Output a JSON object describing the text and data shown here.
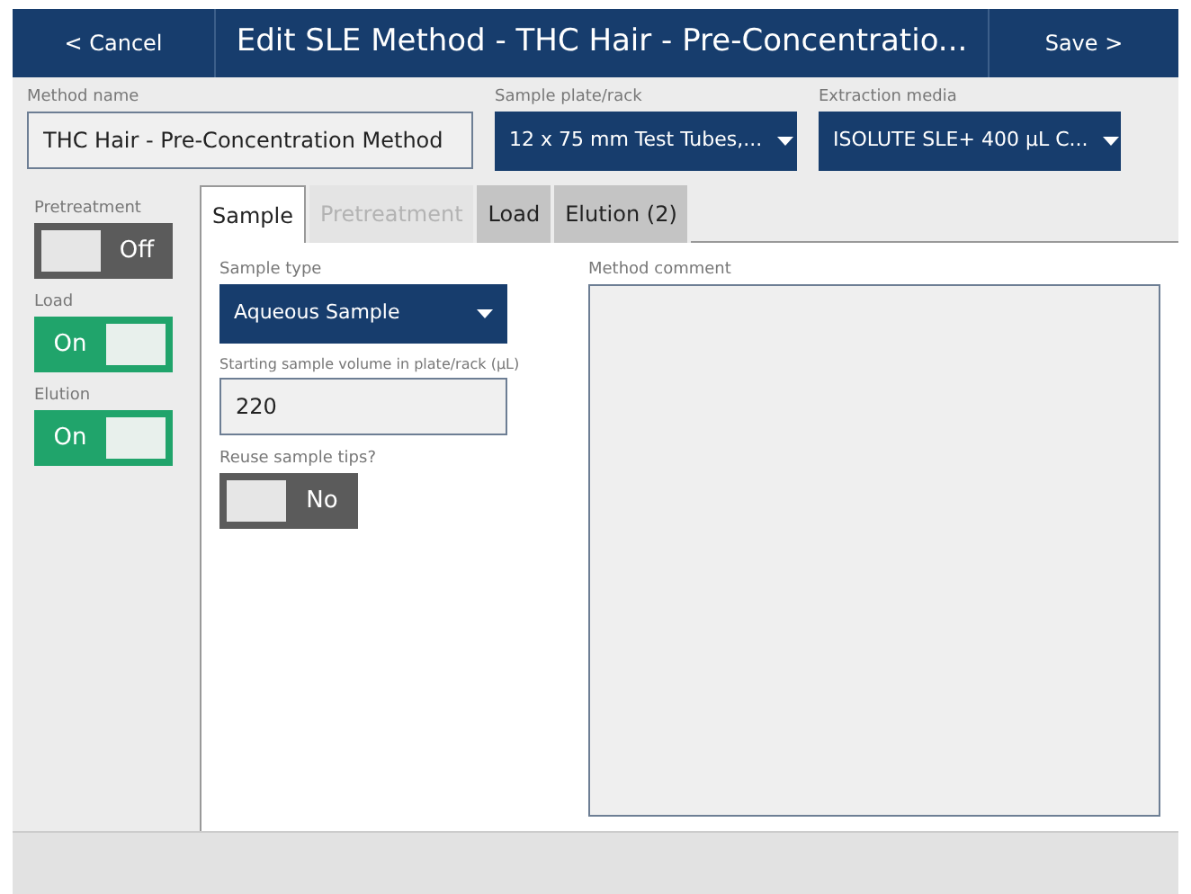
{
  "header": {
    "cancel": "< Cancel",
    "title": "Edit SLE Method - THC Hair - Pre-Concentratio...",
    "save": "Save >"
  },
  "method_name": {
    "label": "Method name",
    "value": "THC Hair - Pre-Concentration Method"
  },
  "sample_plate": {
    "label": "Sample plate/rack",
    "value": "12 x 75 mm Test Tubes,..."
  },
  "extraction_media": {
    "label": "Extraction media",
    "value": "ISOLUTE SLE+ 400 µL C..."
  },
  "steps": [
    {
      "label": "Pretreatment",
      "on": false,
      "state": "Off"
    },
    {
      "label": "Load",
      "on": true,
      "state": "On"
    },
    {
      "label": "Elution",
      "on": true,
      "state": "On"
    }
  ],
  "tabs": [
    {
      "label": "Sample",
      "selected": true,
      "disabled": false
    },
    {
      "label": "Pretreatment",
      "selected": false,
      "disabled": true
    },
    {
      "label": "Load",
      "selected": false,
      "disabled": false
    },
    {
      "label": "Elution (2)",
      "selected": false,
      "disabled": false
    }
  ],
  "sample_type": {
    "label": "Sample type",
    "value": "Aqueous Sample"
  },
  "sample_volume": {
    "label": "Starting sample volume in plate/rack (µL)",
    "value": "220"
  },
  "reuse_tips": {
    "label": "Reuse sample tips?",
    "on": false,
    "state": "No"
  },
  "method_comment": {
    "label": "Method comment"
  }
}
